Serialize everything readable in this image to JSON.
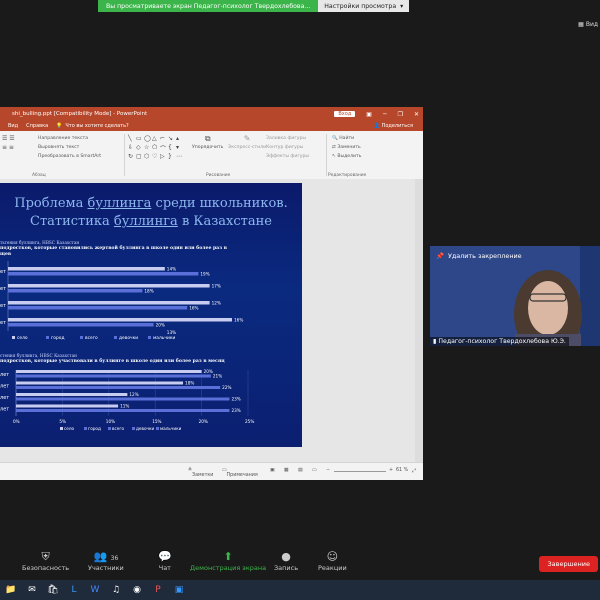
{
  "share_bar": {
    "message": "Вы просматриваете экран Педагог-психолог Твердохлебова...",
    "options": "Настройки просмотра"
  },
  "view_button": {
    "label": "Вид"
  },
  "ppt": {
    "title": "shi_bulling.ppt [Compatibility Mode] - PowerPoint",
    "view_tab": "Вход",
    "menu": [
      "Вид",
      "Справка"
    ],
    "tell_me": "Что вы хотите сделать?",
    "share": "Поделиться",
    "ribbon": {
      "para_items": [
        "Направление текста",
        "Выровнять текст",
        "Преобразовать в SmartArt"
      ],
      "para_label": "Абзац",
      "arrange": "Упорядочить",
      "quick_styles": "Экспресс-стили",
      "shape_items": [
        "Заливка фигуры",
        "Контур фигуры",
        "Эффекты фигуры"
      ],
      "draw_label": "Рисование",
      "edit_items": [
        "Найти",
        "Заменить",
        "Выделить"
      ],
      "edit_label": "Редактирование"
    },
    "slide": {
      "title_line1_a": "Проблема ",
      "title_line1_b": "буллинга",
      "title_line1_c": " среди школьников.",
      "title_line2_a": "Статистика ",
      "title_line2_b": "буллинга",
      "title_line2_c": " в Казахстане",
      "chart1_source": "тьтения буллинга, HBSC Казахстан",
      "chart1_caption": "подростков, которые становились жертвой буллинга в школе один или более раз в",
      "chart1_caption2": "щев",
      "chart2_source": "стения буллинга, HBSC Казахстан",
      "chart2_caption": "подростков, которые участвовали в буллинге в школе один или более раз в месяц"
    },
    "status": {
      "notes": "Заметки",
      "comments": "Примечания",
      "zoom": "61 %"
    }
  },
  "chart_data": [
    {
      "type": "bar",
      "orientation": "horizontal",
      "category_labels": [
        "ет",
        "ет",
        "ет",
        "ет"
      ],
      "series": [
        {
          "name": "село",
          "values": [
            14,
            18,
            18,
            20
          ]
        },
        {
          "name": "город",
          "values": [
            17,
            12,
            16,
            13
          ]
        }
      ],
      "data_labels": [
        "14%",
        "19%",
        "17%",
        "18%",
        "12%",
        "16%",
        "16%",
        "20%",
        "13%"
      ],
      "legend": [
        "село",
        "город",
        "всего",
        "девочки",
        "мальчики"
      ],
      "legend_position": "bottom"
    },
    {
      "type": "bar",
      "orientation": "horizontal",
      "categories": [
        "лет",
        "лет",
        "лет",
        "лет"
      ],
      "series": [
        {
          "name": "село",
          "values": [
            20,
            18,
            12,
            11
          ]
        },
        {
          "name": "город",
          "values": [
            21,
            22,
            23,
            23
          ]
        }
      ],
      "data_labels": [
        "20%",
        "21%",
        "18%",
        "22%",
        "12%",
        "23%",
        "11%",
        "23%"
      ],
      "xticks": [
        "0%",
        "5%",
        "10%",
        "15%",
        "20%",
        "25%"
      ],
      "xlim": [
        0,
        25
      ],
      "legend": [
        "село",
        "город",
        "всего",
        "девочки",
        "мальчики"
      ],
      "legend_position": "bottom"
    }
  ],
  "video": {
    "unpin": "Удалить закрепление",
    "name": "Педагог-психолог Твердохлебова Ю.Э."
  },
  "toolbar": {
    "security": "Безопасность",
    "participants": "Участники",
    "participants_count": "36",
    "chat": "Чат",
    "share": "Демонстрация экрана",
    "record": "Запись",
    "reactions": "Реакции",
    "end": "Завершение"
  }
}
